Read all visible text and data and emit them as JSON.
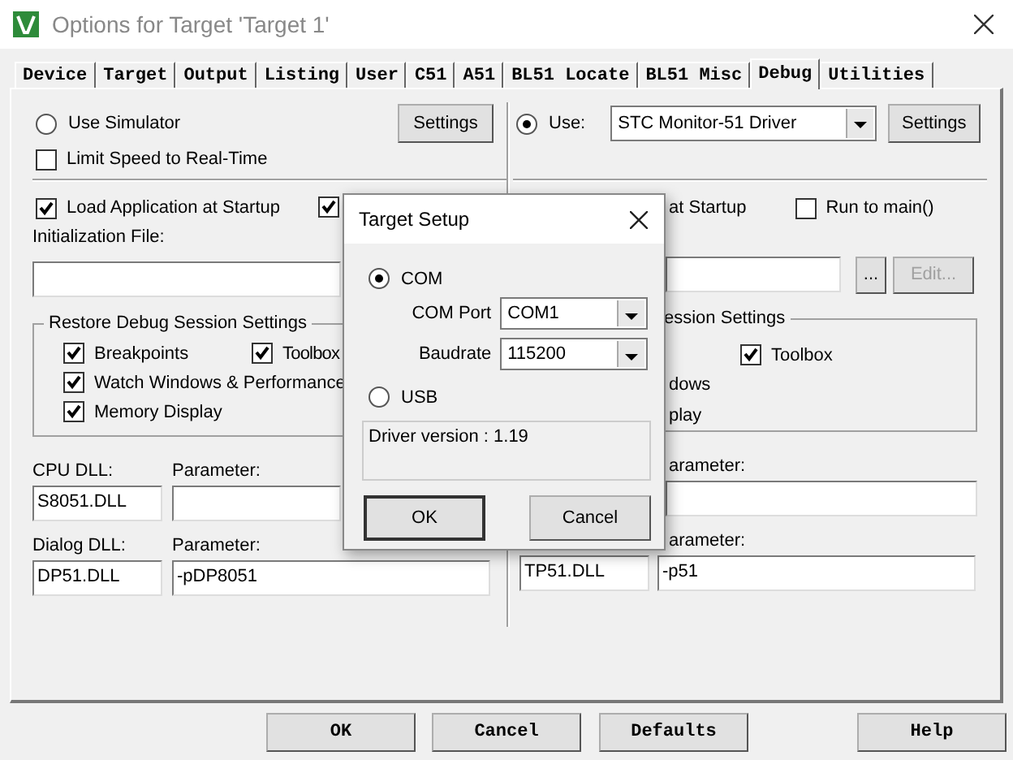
{
  "window": {
    "title": "Options for Target 'Target 1'"
  },
  "tabs": [
    {
      "label": "Device",
      "selected": false
    },
    {
      "label": "Target",
      "selected": false
    },
    {
      "label": "Output",
      "selected": false
    },
    {
      "label": "Listing",
      "selected": false
    },
    {
      "label": "User",
      "selected": false
    },
    {
      "label": "C51",
      "selected": false
    },
    {
      "label": "A51",
      "selected": false
    },
    {
      "label": "BL51 Locate",
      "selected": false
    },
    {
      "label": "BL51 Misc",
      "selected": false
    },
    {
      "label": "Debug",
      "selected": true
    },
    {
      "label": "Utilities",
      "selected": false
    }
  ],
  "left": {
    "use_simulator": {
      "label": "Use Simulator",
      "selected": false
    },
    "settings_button": "Settings",
    "limit_speed": {
      "label": "Limit Speed to Real-Time",
      "checked": false
    },
    "load_app": {
      "label": "Load Application at Startup",
      "checked": true
    },
    "breakpoints_at_startup": {
      "checked": true
    },
    "init_file_label": "Initialization File:",
    "restore_group": {
      "title": "Restore Debug Session Settings",
      "options": [
        {
          "label": "Breakpoints",
          "checked": true
        },
        {
          "label": "Toolbox",
          "checked": true
        },
        {
          "label": "Watch Windows & Performance",
          "checked": true
        },
        {
          "label": "Memory Display",
          "checked": true
        }
      ]
    },
    "cpu_dll_label": "CPU DLL:",
    "cpu_param_label": "Parameter:",
    "cpu_dll": "S8051.DLL",
    "dialog_dll_label": "Dialog DLL:",
    "dialog_param_label": "Parameter:",
    "dialog_dll": "DP51.DLL",
    "dialog_param": "-pDP8051"
  },
  "right": {
    "use": {
      "label": "Use:",
      "selected": true
    },
    "driver": "STC Monitor-51 Driver",
    "settings_button": "Settings",
    "load_app_fragment": "at Startup",
    "run_to_main": {
      "label": "Run to main()",
      "checked": false
    },
    "browse_button": "...",
    "edit_button": {
      "label": "Edit...",
      "disabled": true
    },
    "restore_group": {
      "title": "ession Settings",
      "toolbox": {
        "label": "Toolbox",
        "checked": true
      },
      "fragments": [
        "dows",
        "play"
      ]
    },
    "cpu_param_label": "arameter:",
    "dialog_param_label": "arameter:",
    "dialog_dll": "TP51.DLL",
    "dialog_param": "-p51"
  },
  "target_setup": {
    "title": "Target Setup",
    "com": {
      "label": "COM",
      "selected": true
    },
    "com_port_label": "COM Port",
    "com_port": "COM1",
    "baudrate_label": "Baudrate",
    "baudrate": "115200",
    "usb": {
      "label": "USB",
      "selected": false
    },
    "driver_version": "Driver version : 1.19",
    "buttons": [
      "OK",
      "Cancel"
    ]
  },
  "buttons": [
    "OK",
    "Cancel",
    "Defaults",
    "Help"
  ]
}
